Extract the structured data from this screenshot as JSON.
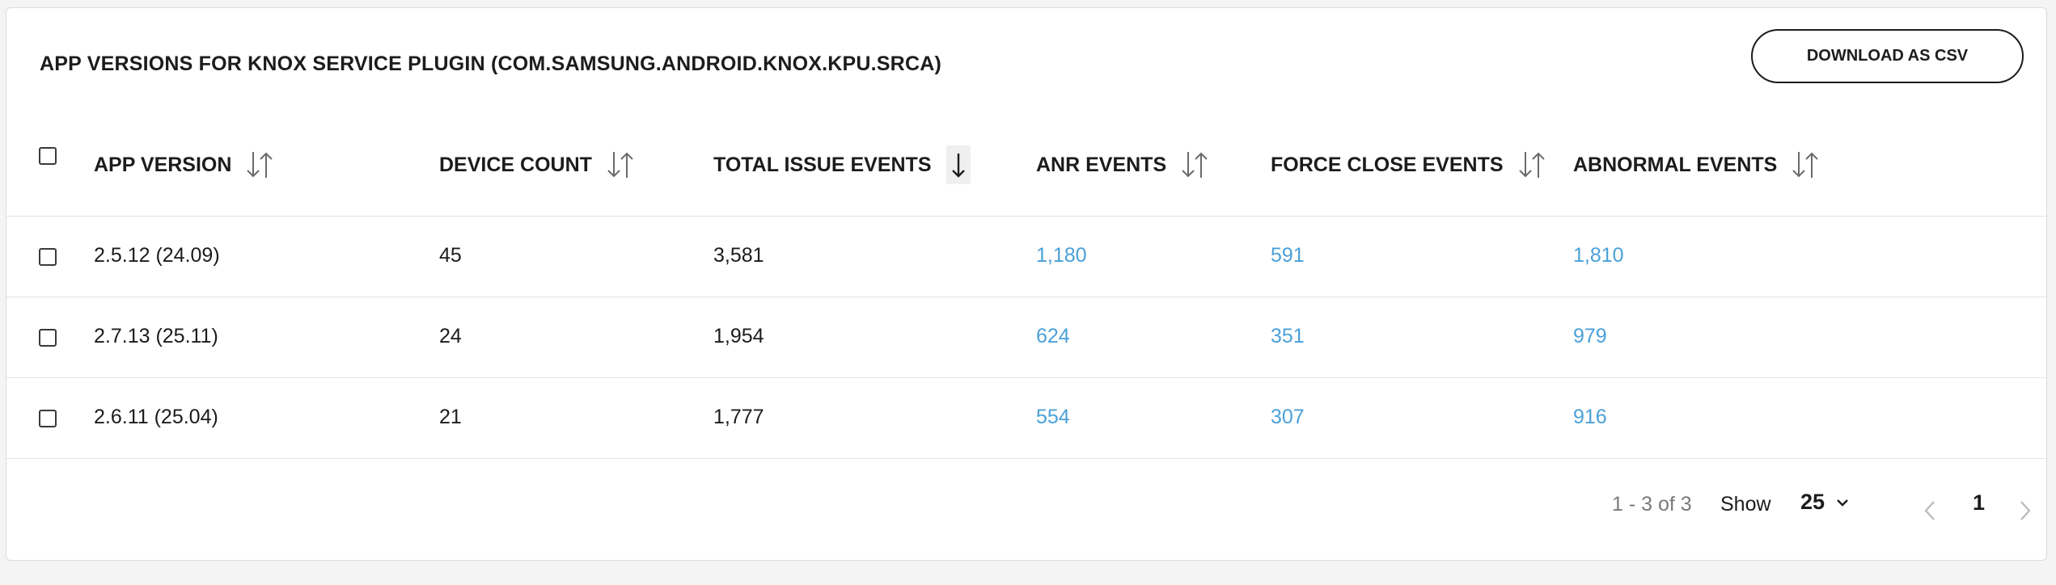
{
  "title": "APP VERSIONS FOR KNOX SERVICE PLUGIN (COM.SAMSUNG.ANDROID.KNOX.KPU.SRCA)",
  "download_label": "DOWNLOAD AS CSV",
  "columns": [
    {
      "key": "app_version",
      "label": "APP VERSION",
      "sort": "none"
    },
    {
      "key": "device_count",
      "label": "DEVICE COUNT",
      "sort": "none"
    },
    {
      "key": "total_issue_events",
      "label": "TOTAL ISSUE EVENTS",
      "sort": "desc"
    },
    {
      "key": "anr_events",
      "label": "ANR EVENTS",
      "sort": "none"
    },
    {
      "key": "force_close_events",
      "label": "FORCE CLOSE EVENTS",
      "sort": "none"
    },
    {
      "key": "abnormal_events",
      "label": "ABNORMAL EVENTS",
      "sort": "none"
    }
  ],
  "rows": [
    {
      "app_version": "2.5.12 (24.09)",
      "device_count": "45",
      "total_issue_events": "3,581",
      "anr_events": "1,180",
      "force_close_events": "591",
      "abnormal_events": "1,810"
    },
    {
      "app_version": "2.7.13 (25.11)",
      "device_count": "24",
      "total_issue_events": "1,954",
      "anr_events": "624",
      "force_close_events": "351",
      "abnormal_events": "979"
    },
    {
      "app_version": "2.6.11 (25.04)",
      "device_count": "21",
      "total_issue_events": "1,777",
      "anr_events": "554",
      "force_close_events": "307",
      "abnormal_events": "916"
    }
  ],
  "pagination": {
    "range": "1 - 3 of 3",
    "show_label": "Show",
    "page_size": "25",
    "current_page": "1"
  },
  "colors": {
    "link": "#4aa0d8",
    "border": "#e2e2e2",
    "text": "#1c1c1c"
  },
  "icons": {
    "sort_both": "sort-arrows-icon",
    "sort_desc": "sort-down-icon",
    "prev": "chevron-left-icon",
    "next": "chevron-right-icon",
    "dropdown": "chevron-down-icon"
  }
}
